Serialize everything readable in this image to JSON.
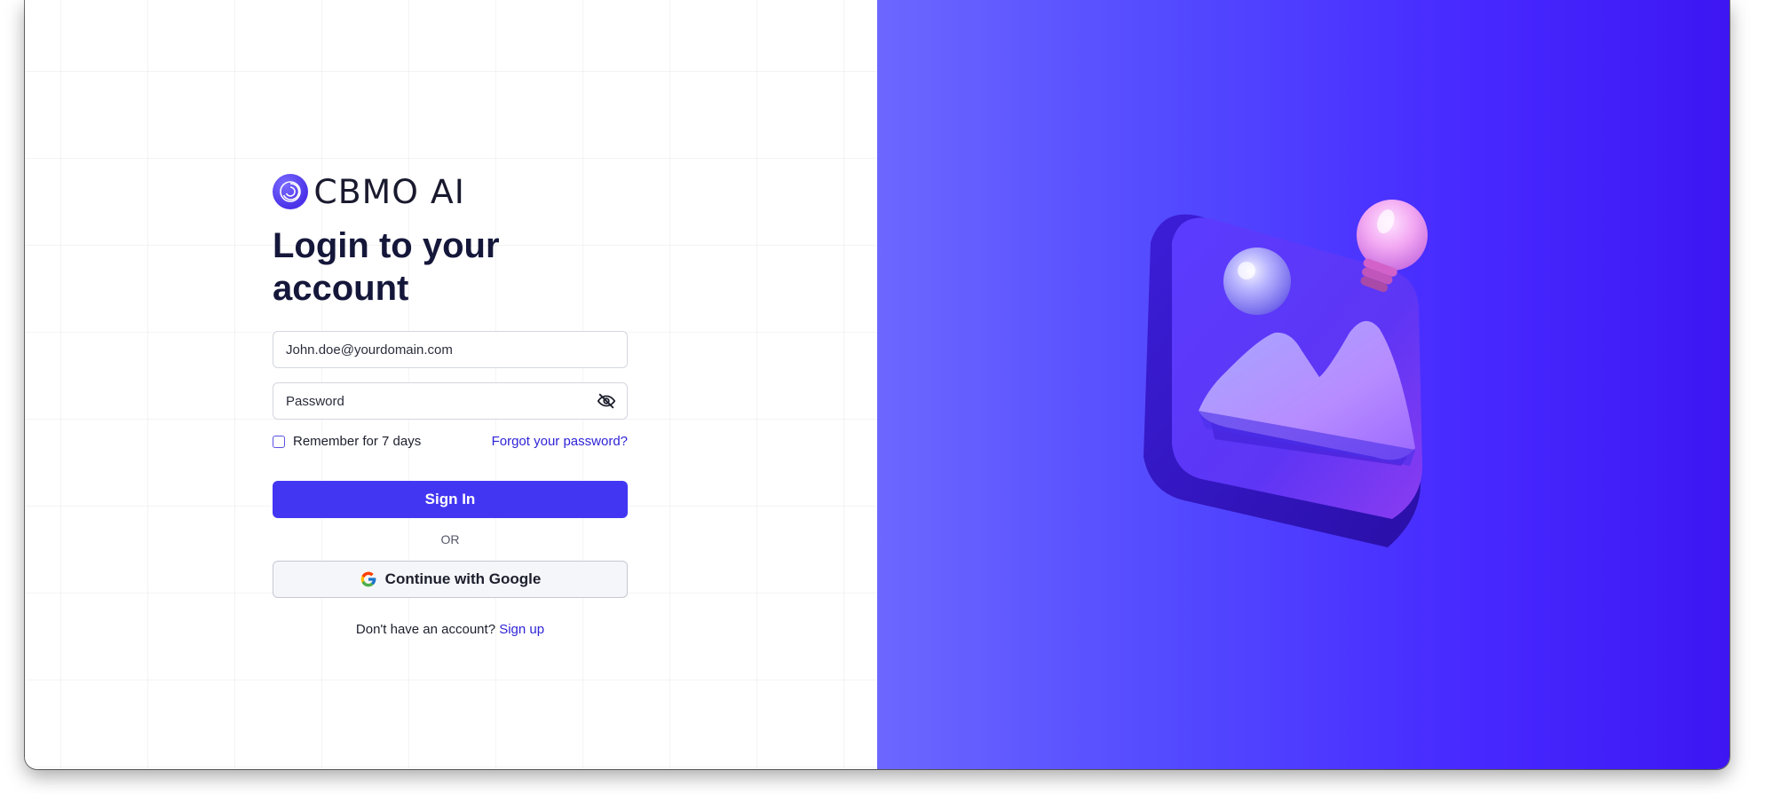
{
  "brand": {
    "name": "CBMO AI"
  },
  "login": {
    "title": "Login to your account",
    "email_placeholder": "John.doe@yourdomain.com",
    "password_placeholder": "Password",
    "remember_label": "Remember for 7 days",
    "forgot_label": "Forgot your password?",
    "sign_in_label": "Sign In",
    "or_label": "OR",
    "google_label": "Continue with Google",
    "no_account_text": "Don't have an account?",
    "sign_up_label": "Sign up"
  },
  "icons": {
    "logo": "brand-logo-icon",
    "password_toggle": "eye-off-icon",
    "google": "google-icon",
    "illustration": "image-placeholder-illustration"
  },
  "colors": {
    "primary": "#4336f2",
    "link": "#2f24d6",
    "heading": "#15173a",
    "panel_gradient_start": "#6c67ff",
    "panel_gradient_end": "#3d16f2"
  }
}
